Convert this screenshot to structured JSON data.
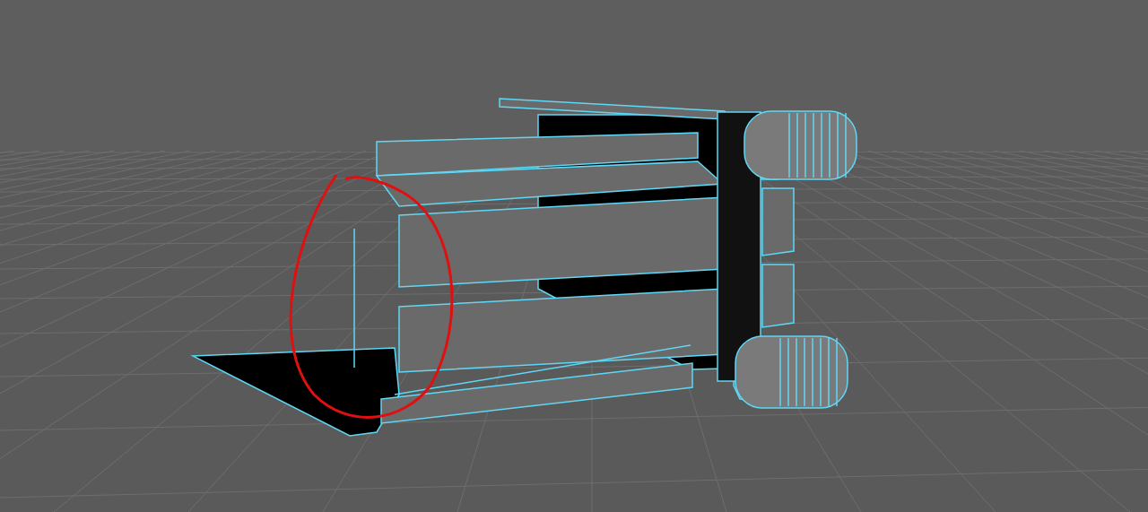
{
  "viewport": {
    "grid": {
      "visible": true
    },
    "model": {
      "selected": true
    },
    "annotation": {
      "visible": true
    }
  }
}
